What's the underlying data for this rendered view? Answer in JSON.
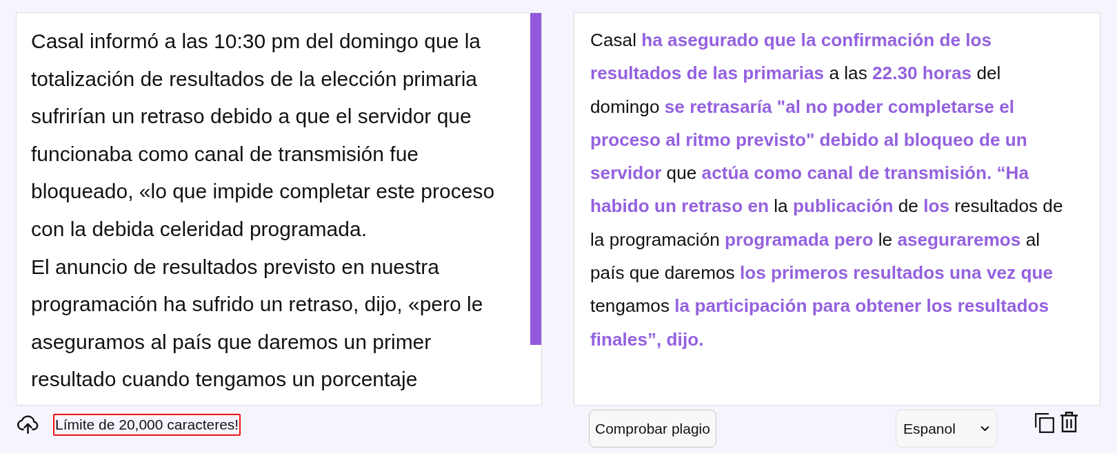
{
  "source_panel": {
    "text": "Casal informó a las 10:30 pm del domingo que la totalización de resultados de la elección primaria sufrirían un retraso debido a que el servidor que funcionaba como canal de transmisión fue bloqueado, «lo que impide completar este proceso con la debida celeridad programada.\nEl anuncio de resultados previsto en nuestra programación ha sufrido un retraso, dijo, «pero le aseguramos al país que daremos un primer resultado cuando tengamos un porcentaje"
  },
  "output_panel": {
    "segments": [
      {
        "text": "Casal ",
        "highlighted": false
      },
      {
        "text": "ha asegurado que la confirmación de los resultados de las primarias",
        "highlighted": true
      },
      {
        "text": " a las ",
        "highlighted": false
      },
      {
        "text": "22.30 horas",
        "highlighted": true
      },
      {
        "text": " del domingo ",
        "highlighted": false
      },
      {
        "text": "se retrasaría \"al no poder completarse el proceso al ritmo previsto\" debido al bloqueo de un servidor",
        "highlighted": true
      },
      {
        "text": " que ",
        "highlighted": false
      },
      {
        "text": "actúa como canal de transmisión. “Ha habido un retraso en",
        "highlighted": true
      },
      {
        "text": " la ",
        "highlighted": false
      },
      {
        "text": "publicación",
        "highlighted": true
      },
      {
        "text": " de ",
        "highlighted": false
      },
      {
        "text": "los",
        "highlighted": true
      },
      {
        "text": " resultados de la programación ",
        "highlighted": false
      },
      {
        "text": "programada pero",
        "highlighted": true
      },
      {
        "text": " le ",
        "highlighted": false
      },
      {
        "text": "aseguraremos",
        "highlighted": true
      },
      {
        "text": " al país que daremos ",
        "highlighted": false
      },
      {
        "text": "los primeros resultados una vez que",
        "highlighted": true
      },
      {
        "text": " tengamos ",
        "highlighted": false
      },
      {
        "text": "la participación para obtener los resultados finales”, dijo.",
        "highlighted": true
      }
    ]
  },
  "footer_left": {
    "limit_notice": "Límite de 20,000 caracteres!"
  },
  "footer_right": {
    "check_plagiarism_button": "Comprobar plagio",
    "language_select": {
      "value": "Espanol"
    }
  }
}
